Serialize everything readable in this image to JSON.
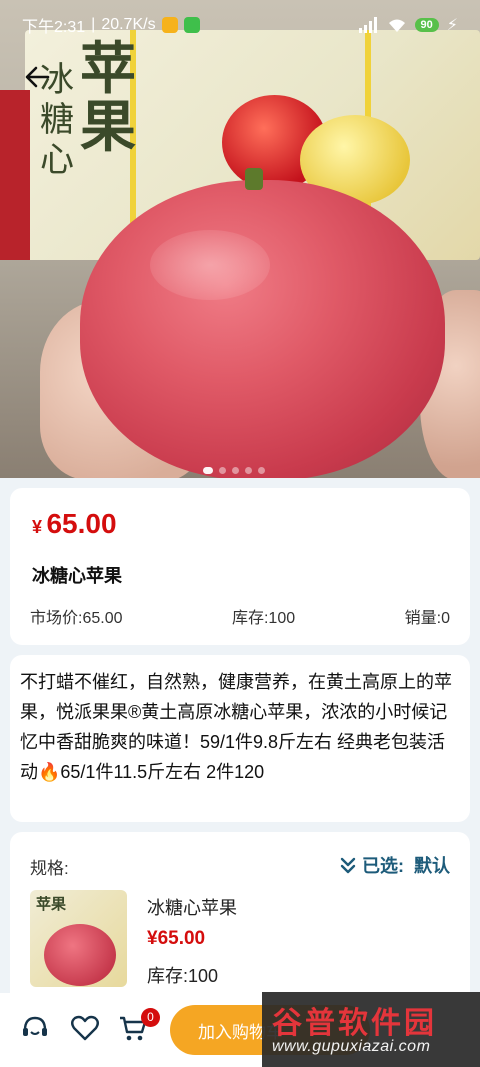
{
  "status_bar": {
    "time": "下午2:31",
    "speed": "20.7K/s",
    "battery": "90"
  },
  "gallery": {
    "image_count": 5,
    "active_index": 0,
    "box_text_main": "苹果",
    "box_text_side": "冰糖心"
  },
  "product": {
    "currency_symbol": "¥",
    "price": "65.00",
    "name": "冰糖心苹果",
    "market_price": "市场价:65.00",
    "stock": "库存:100",
    "sales": "销量:0"
  },
  "description": "不打蜡不催红，自然熟，健康营养，在黄土高原上的苹果，悦派果果®黄土高原冰糖心苹果，浓浓的小时候记忆中香甜脆爽的味道！59/1件9.8斤左右 经典老包装活动🔥65/1件11.5斤左右 2件120",
  "spec": {
    "label": "规格:",
    "selected_label": "已选:",
    "selected_value": "默认",
    "item_name": "冰糖心苹果",
    "item_price": "¥65.00",
    "item_stock": "库存:100"
  },
  "bottom_bar": {
    "cart_count": "0",
    "add_to_cart_label": "加入购物车"
  },
  "watermark": {
    "title": "谷普软件园",
    "url": "www.gupuxiazai.com"
  },
  "colors": {
    "price_red": "#d40d0d",
    "accent_blue": "#1d5b7a",
    "add_cart_orange": "#f5a623"
  }
}
